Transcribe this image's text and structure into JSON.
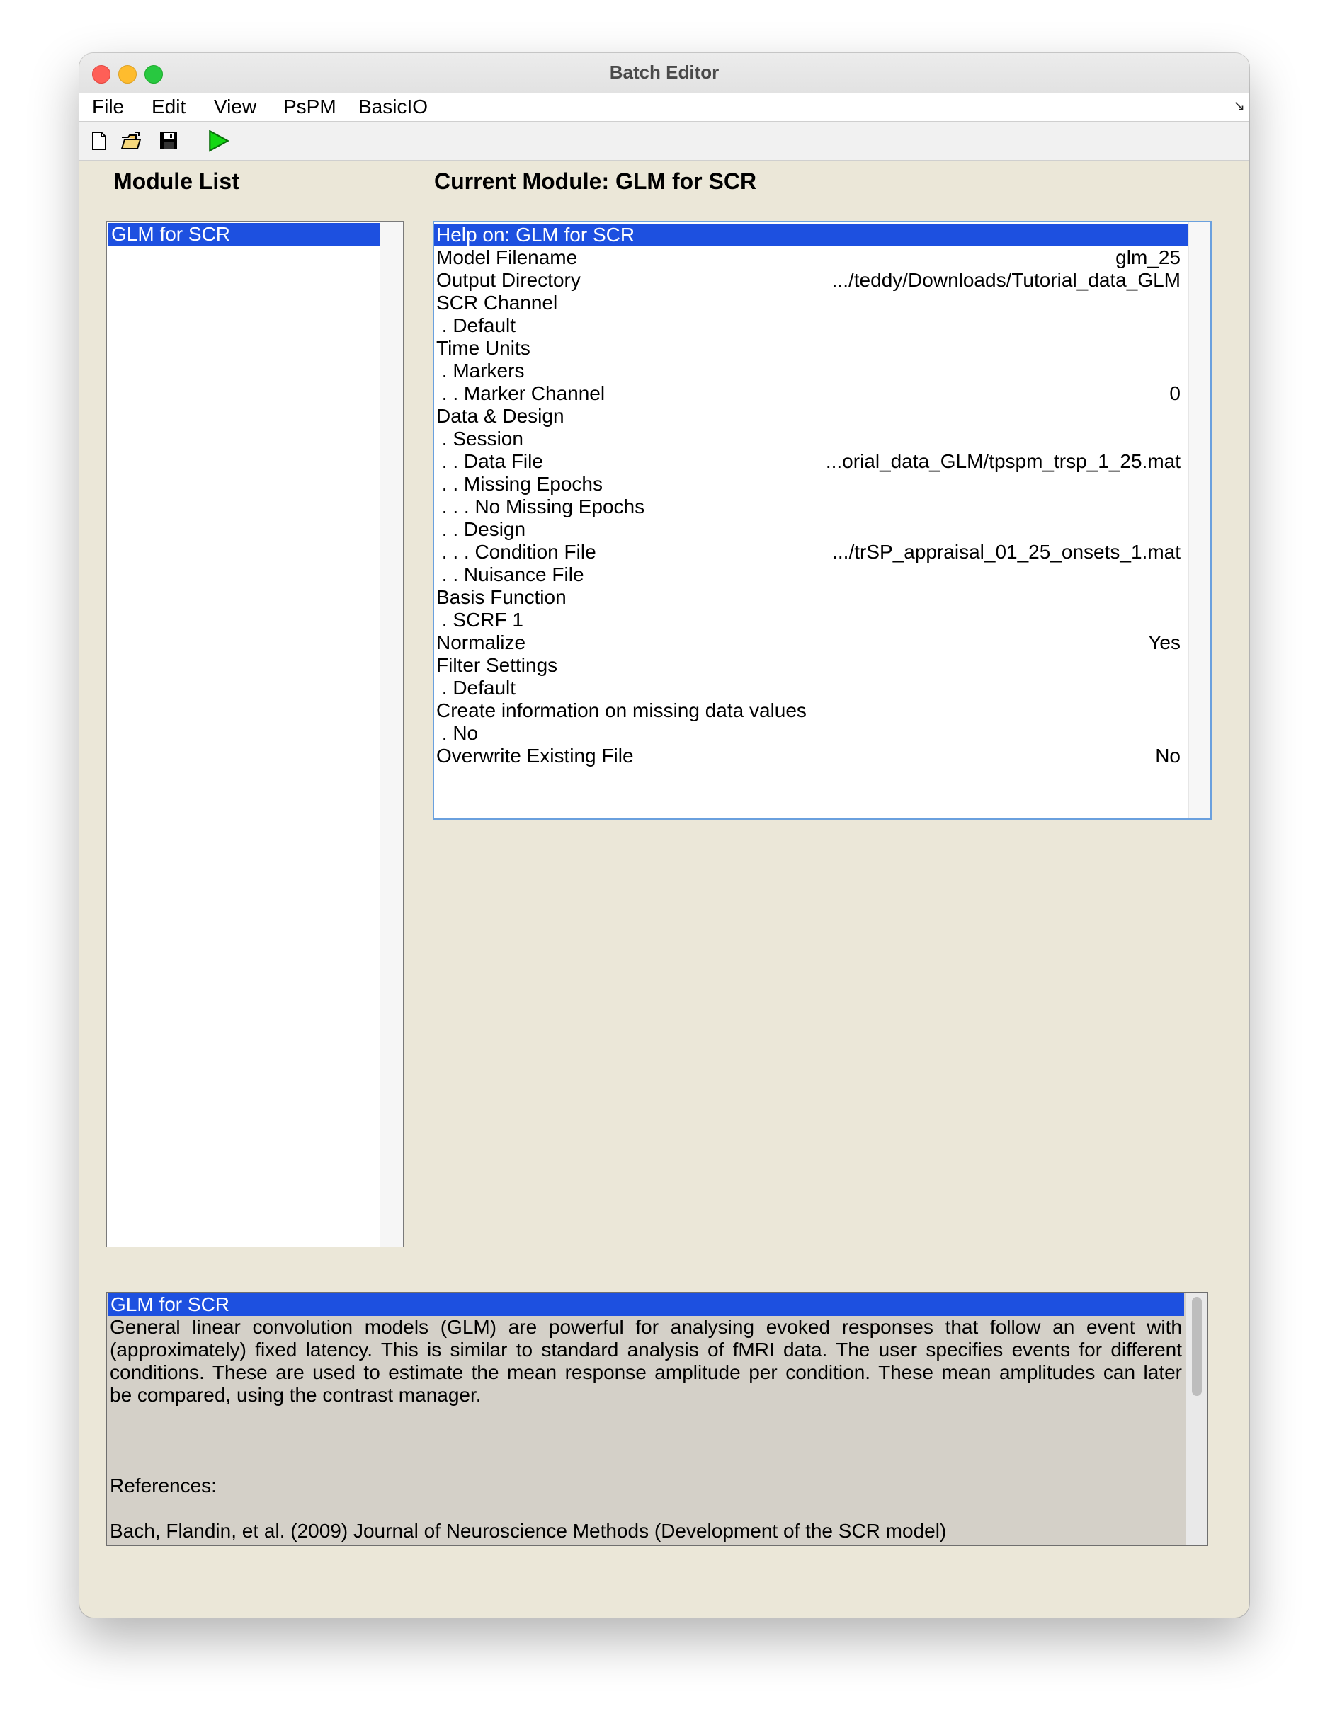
{
  "window": {
    "title": "Batch Editor"
  },
  "menubar": {
    "items": [
      "File",
      "Edit",
      "View",
      "PsPM",
      "BasicIO"
    ],
    "corner_icon": "dock-arrow-icon"
  },
  "toolbar": {
    "icons": [
      "new-file-icon",
      "open-folder-icon",
      "save-icon",
      "run-icon"
    ]
  },
  "module_list": {
    "heading": "Module List",
    "items": [
      "GLM for SCR"
    ],
    "selected_index": 0
  },
  "current_module": {
    "heading": "Current Module: GLM for SCR",
    "rows": [
      {
        "label": "Help on: GLM for SCR",
        "value": "",
        "selected": true
      },
      {
        "label": "Model Filename",
        "value": "glm_25"
      },
      {
        "label": "Output Directory",
        "value": ".../teddy/Downloads/Tutorial_data_GLM"
      },
      {
        "label": "SCR Channel",
        "value": ""
      },
      {
        "label": " . Default",
        "value": ""
      },
      {
        "label": "Time Units",
        "value": ""
      },
      {
        "label": " . Markers",
        "value": ""
      },
      {
        "label": " . . Marker Channel",
        "value": "0"
      },
      {
        "label": "Data & Design",
        "value": ""
      },
      {
        "label": " . Session",
        "value": ""
      },
      {
        "label": " . . Data File",
        "value": "...orial_data_GLM/tpspm_trsp_1_25.mat"
      },
      {
        "label": " . . Missing Epochs",
        "value": ""
      },
      {
        "label": " . . . No Missing Epochs",
        "value": ""
      },
      {
        "label": " . . Design",
        "value": ""
      },
      {
        "label": " . . . Condition File",
        "value": ".../trSP_appraisal_01_25_onsets_1.mat"
      },
      {
        "label": " . . Nuisance File",
        "value": ""
      },
      {
        "label": "Basis Function",
        "value": ""
      },
      {
        "label": " . SCRF 1",
        "value": ""
      },
      {
        "label": "Normalize",
        "value": "Yes"
      },
      {
        "label": "Filter Settings",
        "value": ""
      },
      {
        "label": " . Default",
        "value": ""
      },
      {
        "label": "Create information on missing data values",
        "value": ""
      },
      {
        "label": " . No",
        "value": ""
      },
      {
        "label": "Overwrite Existing File",
        "value": "No"
      }
    ]
  },
  "help": {
    "title": "GLM for SCR",
    "paragraph_lines": [
      "General  linear  convolution  models  (GLM)  are  powerful  for  analysing  evoked  responses  that  follow  an event with",
      "(approximately)  fixed  latency.  This  is  similar to standard analysis of fMRI data. The user specifies events for different",
      "conditions.  These  are used to estimate the mean response amplitude per condition. These mean amplitudes can later",
      "be compared, using the contrast manager."
    ],
    "references_label": "References:",
    "reference": "Bach, Flandin, et al. (2009) Journal of Neuroscience Methods (Development of the SCR model)"
  }
}
